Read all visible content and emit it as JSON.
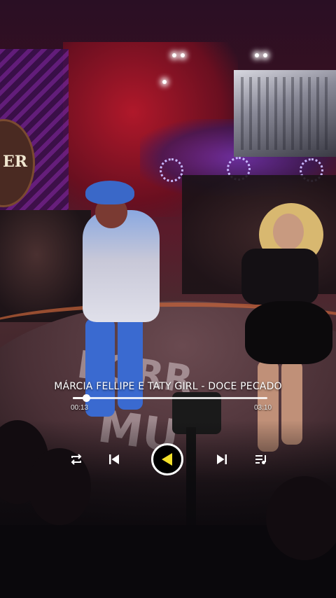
{
  "player": {
    "song_title": "MÁRCIA FELLIPE E TATY GIRL - DOCE PECADO",
    "elapsed": "00:13",
    "total": "03:10",
    "progress_fraction": 0.07,
    "play_accent_color": "#f2df2a"
  },
  "controls": {
    "repeat_icon": "repeat-icon",
    "previous_icon": "skip-previous-icon",
    "play_icon": "play-icon",
    "next_icon": "skip-next-icon",
    "queue_icon": "playlist-icon"
  },
  "scene": {
    "sign_text": "ER",
    "floor_text_1": "FORR",
    "floor_text_2": "MU"
  }
}
